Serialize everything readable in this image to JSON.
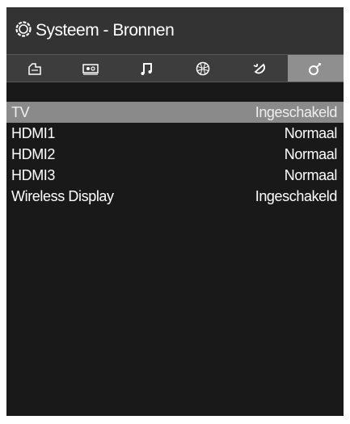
{
  "header": {
    "title": "Systeem - Bronnen",
    "icon": "settings-gear-icon"
  },
  "tabs": [
    {
      "icon": "picture-icon",
      "active": false
    },
    {
      "icon": "tv-source-icon",
      "active": false
    },
    {
      "icon": "music-note-icon",
      "active": false
    },
    {
      "icon": "globe-network-icon",
      "active": false
    },
    {
      "icon": "satellite-dish-icon",
      "active": false
    },
    {
      "icon": "system-settings-icon",
      "active": true
    }
  ],
  "sources": [
    {
      "label": "TV",
      "value": "Ingeschakeld",
      "selected": true
    },
    {
      "label": "HDMI1",
      "value": "Normaal",
      "selected": false
    },
    {
      "label": "HDMI2",
      "value": "Normaal",
      "selected": false
    },
    {
      "label": "HDMI3",
      "value": "Normaal",
      "selected": false
    },
    {
      "label": "Wireless Display",
      "value": "Ingeschakeld",
      "selected": false
    }
  ],
  "colors": {
    "header_bg": "#333333",
    "panel_bg": "#191919",
    "selected_bg": "#8a8a8a",
    "text": "#ffffff"
  }
}
